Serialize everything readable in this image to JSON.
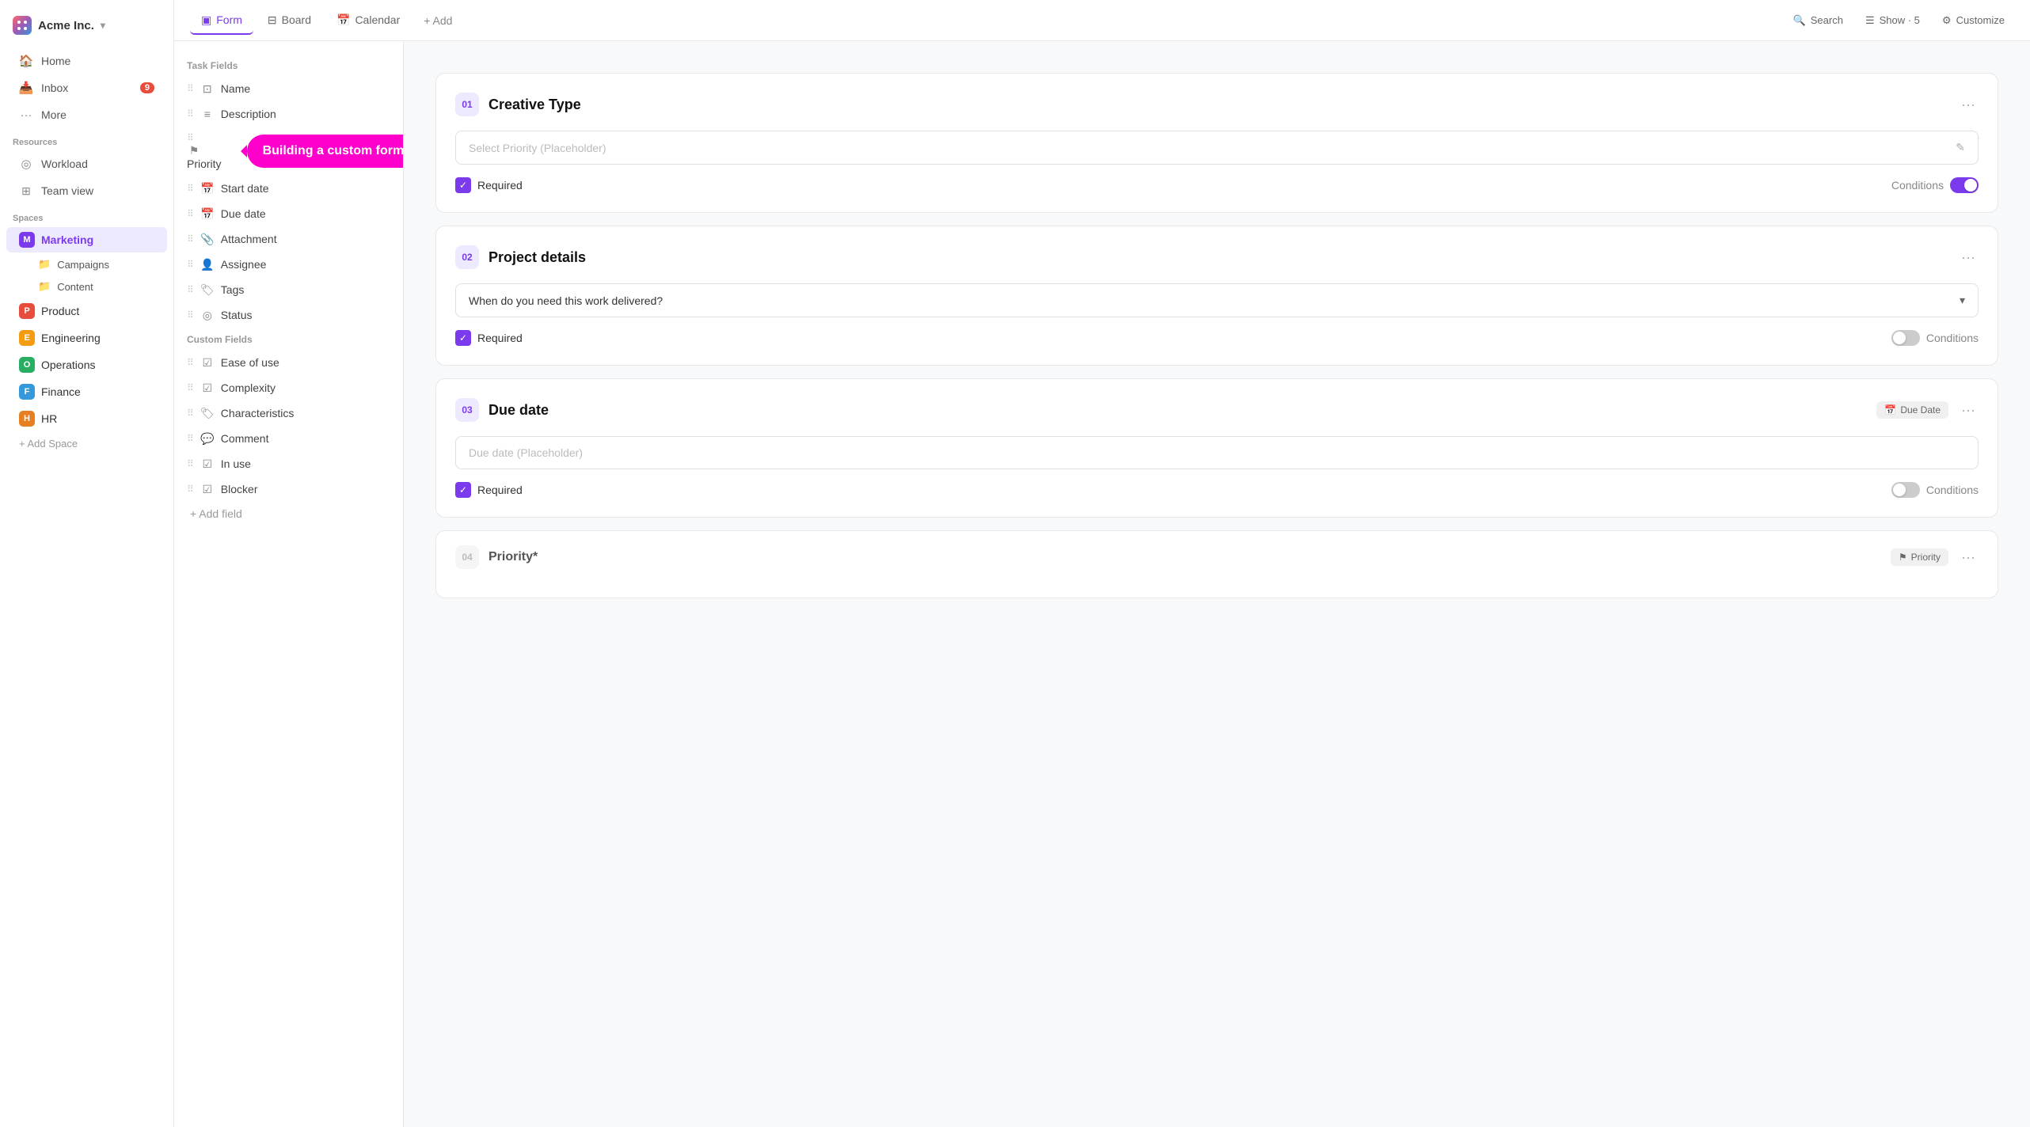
{
  "brand": {
    "name": "Acme Inc.",
    "chevron": "▾"
  },
  "sidebar": {
    "nav_items": [
      {
        "id": "home",
        "label": "Home",
        "icon": "🏠"
      },
      {
        "id": "inbox",
        "label": "Inbox",
        "icon": "📥",
        "badge": "9"
      },
      {
        "id": "more",
        "label": "More",
        "icon": "•••"
      }
    ],
    "resources_label": "Resources",
    "resource_items": [
      {
        "id": "workload",
        "label": "Workload",
        "icon": "◎"
      },
      {
        "id": "team-view",
        "label": "Team view",
        "icon": "⊞"
      }
    ],
    "spaces_label": "Spaces",
    "spaces": [
      {
        "id": "marketing",
        "label": "Marketing",
        "color": "purple",
        "letter": "M",
        "active": true
      },
      {
        "id": "product",
        "label": "Product",
        "color": "red",
        "letter": "P"
      },
      {
        "id": "engineering",
        "label": "Engineering",
        "color": "orange",
        "letter": "E"
      },
      {
        "id": "operations",
        "label": "Operations",
        "color": "green",
        "letter": "O"
      },
      {
        "id": "finance",
        "label": "Finance",
        "color": "blue",
        "letter": "F"
      },
      {
        "id": "hr",
        "label": "HR",
        "color": "orange2",
        "letter": "H"
      }
    ],
    "marketing_sub": [
      {
        "id": "campaigns",
        "label": "Campaigns"
      },
      {
        "id": "content",
        "label": "Content"
      }
    ],
    "add_space_label": "+ Add Space"
  },
  "top_nav": {
    "tabs": [
      {
        "id": "form",
        "label": "Form",
        "icon": "▣",
        "active": true
      },
      {
        "id": "board",
        "label": "Board",
        "icon": "⊟"
      },
      {
        "id": "calendar",
        "label": "Calendar",
        "icon": "📅"
      }
    ],
    "add_label": "+ Add",
    "right_buttons": [
      {
        "id": "search",
        "label": "Search",
        "icon": "🔍"
      },
      {
        "id": "show",
        "label": "Show · 5",
        "icon": "☰"
      },
      {
        "id": "customize",
        "label": "Customize",
        "icon": "⚙"
      }
    ]
  },
  "fields_panel": {
    "task_fields_label": "Task Fields",
    "task_fields": [
      {
        "id": "name",
        "label": "Name",
        "icon": "⊡"
      },
      {
        "id": "description",
        "label": "Description",
        "icon": "≡"
      },
      {
        "id": "priority",
        "label": "Priority",
        "icon": "⚑"
      },
      {
        "id": "start-date",
        "label": "Start date",
        "icon": "📅"
      },
      {
        "id": "due-date",
        "label": "Due date",
        "icon": "📅"
      },
      {
        "id": "attachment",
        "label": "Attachment",
        "icon": "📎"
      },
      {
        "id": "assignee",
        "label": "Assignee",
        "icon": "👤"
      },
      {
        "id": "tags",
        "label": "Tags",
        "icon": "🏷"
      },
      {
        "id": "status",
        "label": "Status",
        "icon": "◎"
      }
    ],
    "custom_fields_label": "Custom Fields",
    "custom_fields": [
      {
        "id": "ease-of-use",
        "label": "Ease of use",
        "icon": "☑"
      },
      {
        "id": "complexity",
        "label": "Complexity",
        "icon": "☑"
      },
      {
        "id": "characteristics",
        "label": "Characteristics",
        "icon": "🏷"
      },
      {
        "id": "comment",
        "label": "Comment",
        "icon": "💬"
      },
      {
        "id": "in-use",
        "label": "In use",
        "icon": "☑"
      },
      {
        "id": "blocker",
        "label": "Blocker",
        "icon": "☑"
      }
    ],
    "add_field_label": "+ Add field"
  },
  "form_cards": [
    {
      "id": "card-1",
      "num": "01",
      "title": "Creative Type",
      "placeholder": "Select Priority (Placeholder)",
      "input_type": "text",
      "required": true,
      "conditions_label": "Conditions",
      "conditions_toggle": true,
      "badge": null
    },
    {
      "id": "card-2",
      "num": "02",
      "title": "Project details",
      "select_value": "When do you need this work delivered?",
      "input_type": "select",
      "required": true,
      "conditions_label": "Conditions",
      "conditions_toggle": false,
      "badge": null
    },
    {
      "id": "card-3",
      "num": "03",
      "title": "Due date",
      "placeholder": "Due date (Placeholder)",
      "input_type": "text",
      "required": true,
      "conditions_label": "Conditions",
      "conditions_toggle": false,
      "badge_label": "Due Date",
      "badge_icon": "📅"
    },
    {
      "id": "card-4",
      "num": "04",
      "title": "Priority*",
      "input_type": "none",
      "required": false,
      "conditions_label": "",
      "conditions_toggle": false,
      "badge_label": "Priority",
      "badge_icon": "⚑"
    }
  ],
  "tooltip": {
    "text": "Building a custom form"
  },
  "required_label": "Required",
  "conditions_label": "Conditions"
}
